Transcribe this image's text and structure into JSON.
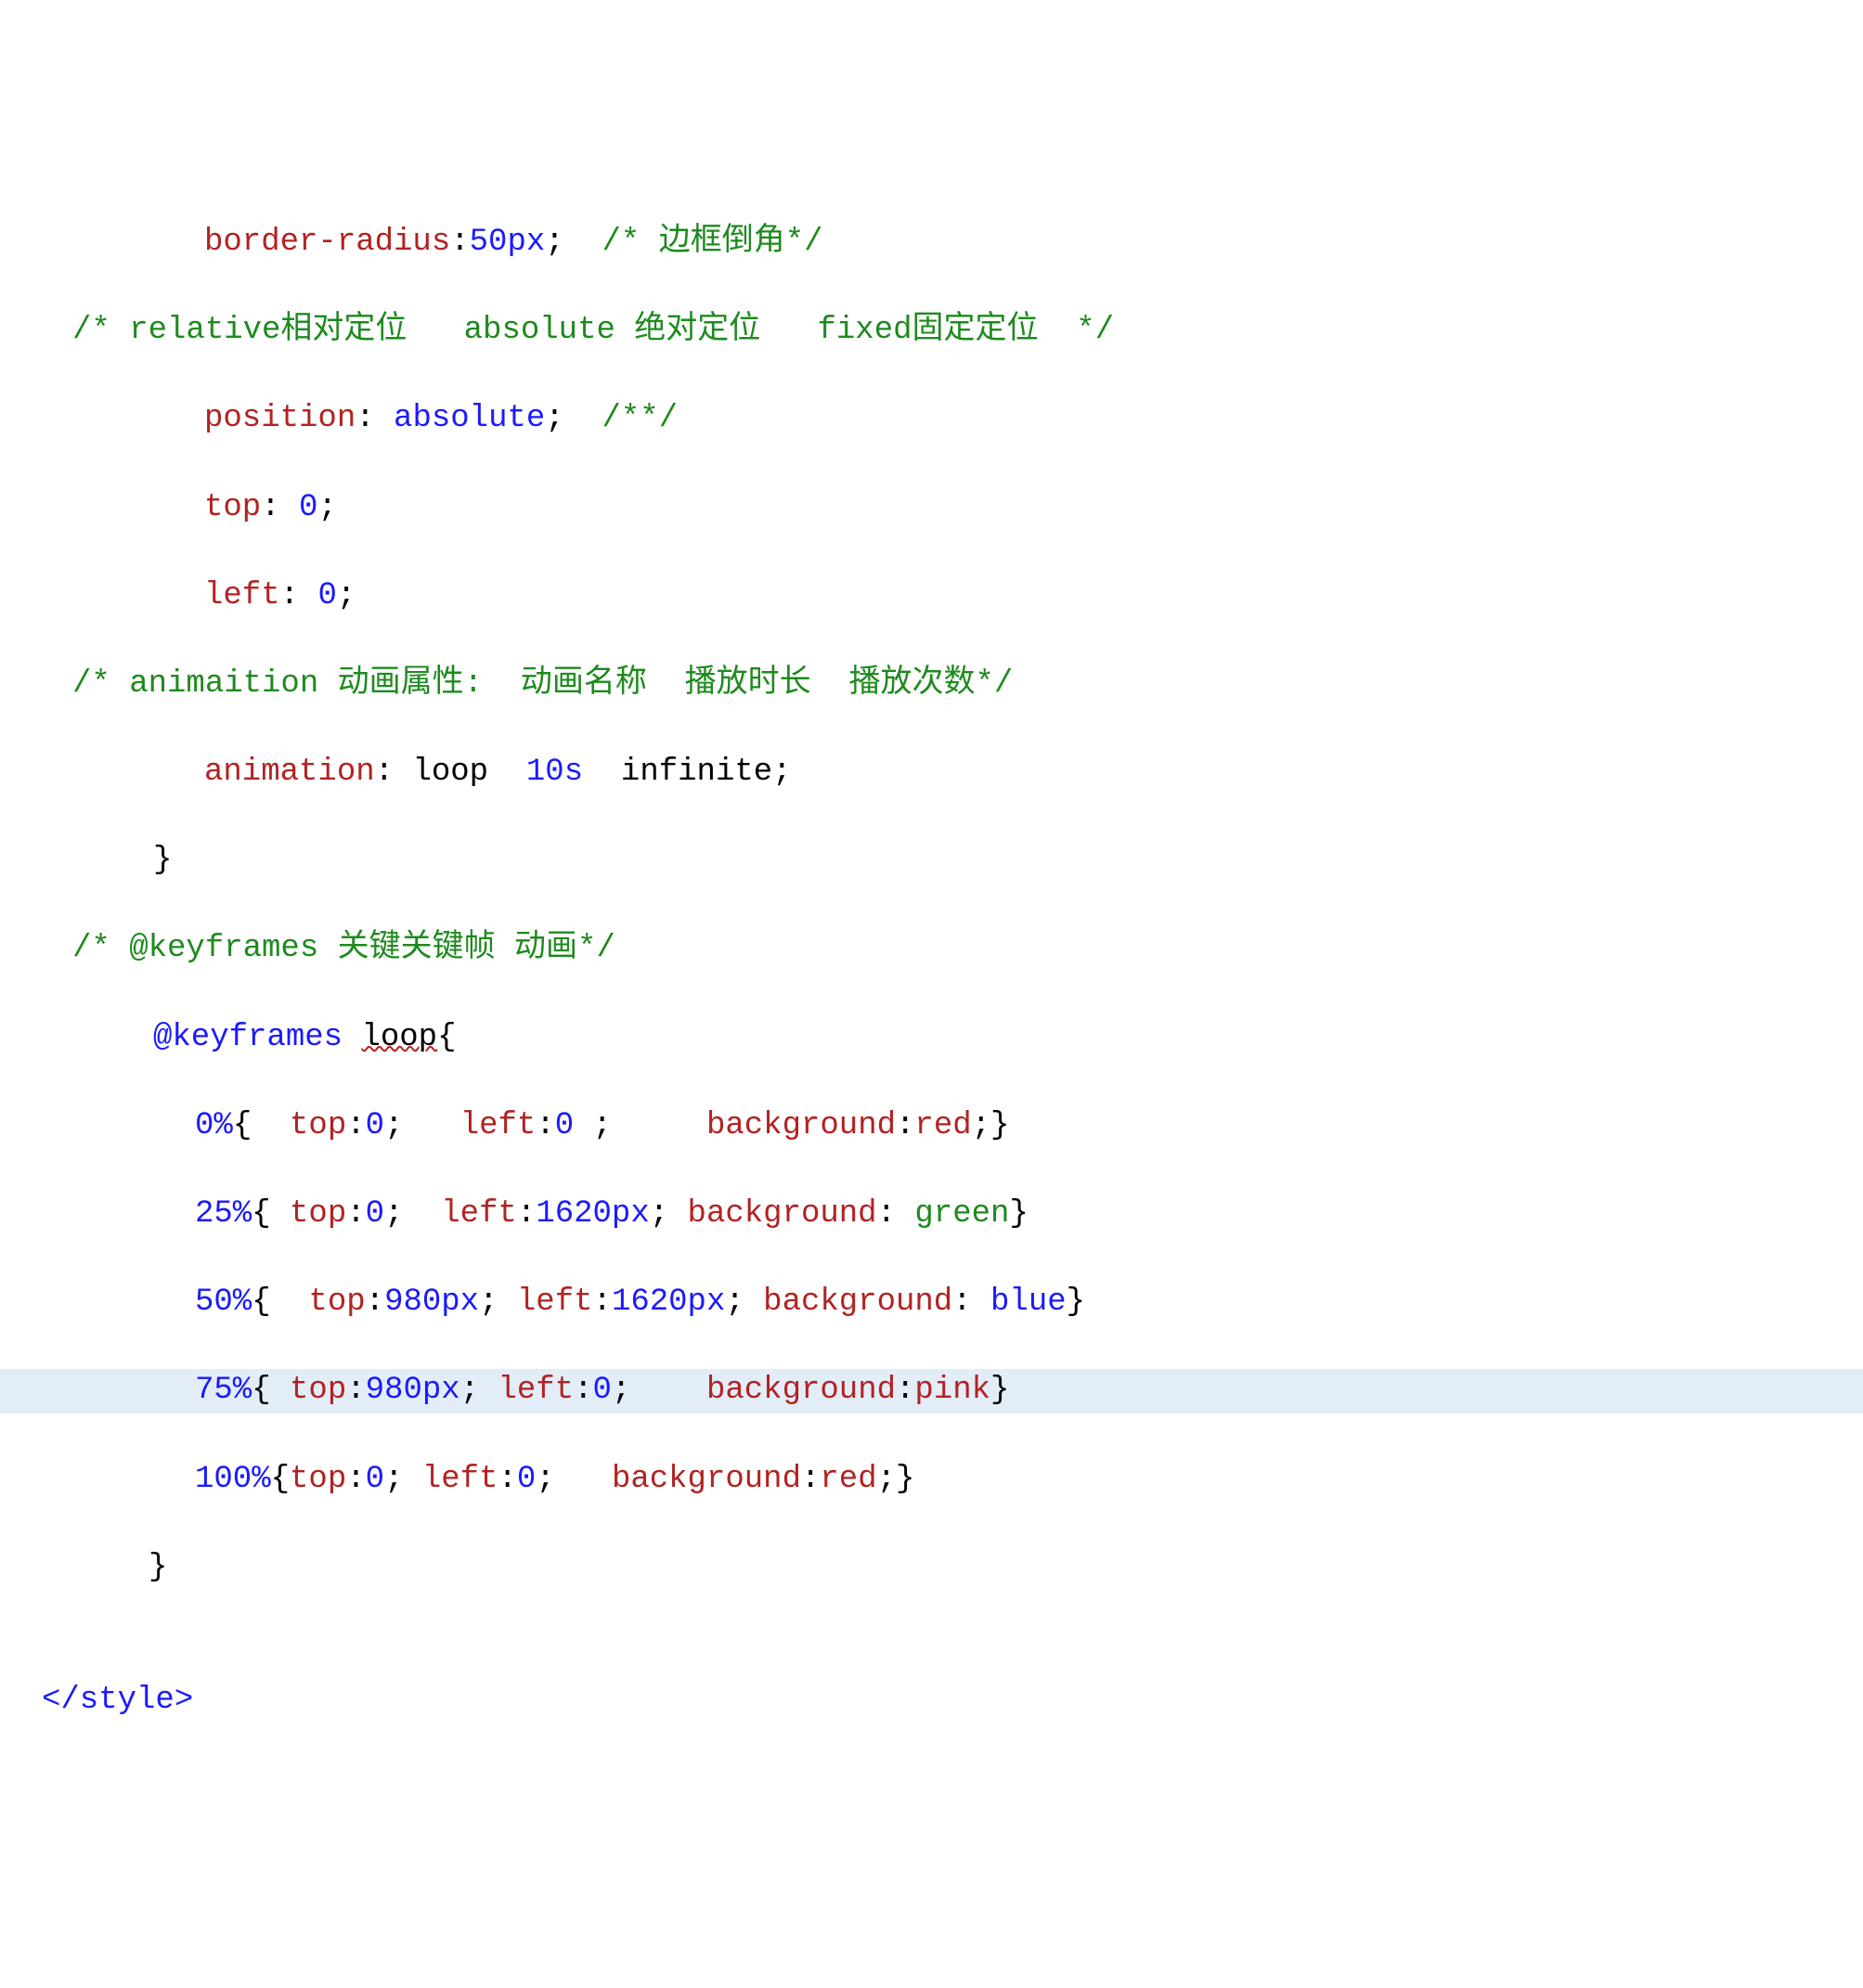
{
  "code": {
    "l1_border_radius": {
      "prop": "border-radius",
      "colon": ":",
      "val": "50px",
      "semi": ";",
      "comment": "/* 边框倒角*/"
    },
    "l2_comment": "/* relative相对定位   absolute 绝对定位   fixed固定定位  */",
    "l3_position": {
      "prop": "position",
      "colon": ": ",
      "val": "absolute",
      "semi": ";",
      "comment": "/**/"
    },
    "l4_top": {
      "prop": "top",
      "colon": ": ",
      "val": "0",
      "semi": ";"
    },
    "l5_left": {
      "prop": "left",
      "colon": ": ",
      "val": "0",
      "semi": ";"
    },
    "l6_comment": "/* animaition 动画属性:  动画名称  播放时长  播放次数*/",
    "l7_animation": {
      "prop": "animation",
      "colon": ": ",
      "v1": "loop",
      "sp1": "  ",
      "v2": "10s",
      "sp2": "  ",
      "v3": "infinite",
      "semi": ";"
    },
    "l8_brace": "}",
    "l9_comment": "/* @keyframes 关键关键帧 动画*/",
    "l10_kf": {
      "at": "@keyframes",
      "sp": " ",
      "name": "loop",
      "brace": "{"
    },
    "l11": {
      "pct": "0%",
      "br": "{",
      "sp1": "  ",
      "p1": "top",
      "c1": ":",
      "v1": "0",
      "s1": ";",
      "sp2": "   ",
      "p2": "left",
      "c2": ":",
      "v2": "0",
      "sp3": " ",
      "s2": ";",
      "sp4": "     ",
      "p3": "background",
      "c3": ":",
      "v3": "red",
      "s3": ";",
      "brc": "}"
    },
    "l12": {
      "pct": "25%",
      "br": "{",
      "sp1": " ",
      "p1": "top",
      "c1": ":",
      "v1": "0",
      "s1": ";",
      "sp2": "  ",
      "p2": "left",
      "c2": ":",
      "v2": "1620px",
      "s2": ";",
      "sp3": " ",
      "p3": "background",
      "c3": ": ",
      "v3": "green",
      "brc": "}"
    },
    "l13": {
      "pct": "50%",
      "br": "{",
      "sp1": "  ",
      "p1": "top",
      "c1": ":",
      "v1": "980px",
      "s1": ";",
      "sp2": " ",
      "p2": "left",
      "c2": ":",
      "v2": "1620px",
      "s2": ";",
      "sp3": " ",
      "p3": "background",
      "c3": ": ",
      "v3": "blue",
      "brc": "}"
    },
    "l14": {
      "pct": "75%",
      "br": "{",
      "sp1": " ",
      "p1": "top",
      "c1": ":",
      "v1": "980px",
      "s1": ";",
      "sp2": " ",
      "p2": "left",
      "c2": ":",
      "v2": "0",
      "s2": ";",
      "sp3": "    ",
      "p3": "background",
      "c3": ":",
      "v3": "pink",
      "brc": "}"
    },
    "l15": {
      "pct": "100%",
      "br": "{",
      "p1": "top",
      "c1": ":",
      "v1": "0",
      "s1": ";",
      "sp2": " ",
      "p2": "left",
      "c2": ":",
      "v2": "0",
      "s2": ";",
      "sp3": "   ",
      "p3": "background",
      "c3": ":",
      "v3": "red",
      "s3": ";",
      "brc": "}"
    },
    "l16_brace": "}",
    "l17_empty": "",
    "l18_style_close": "</style>"
  }
}
